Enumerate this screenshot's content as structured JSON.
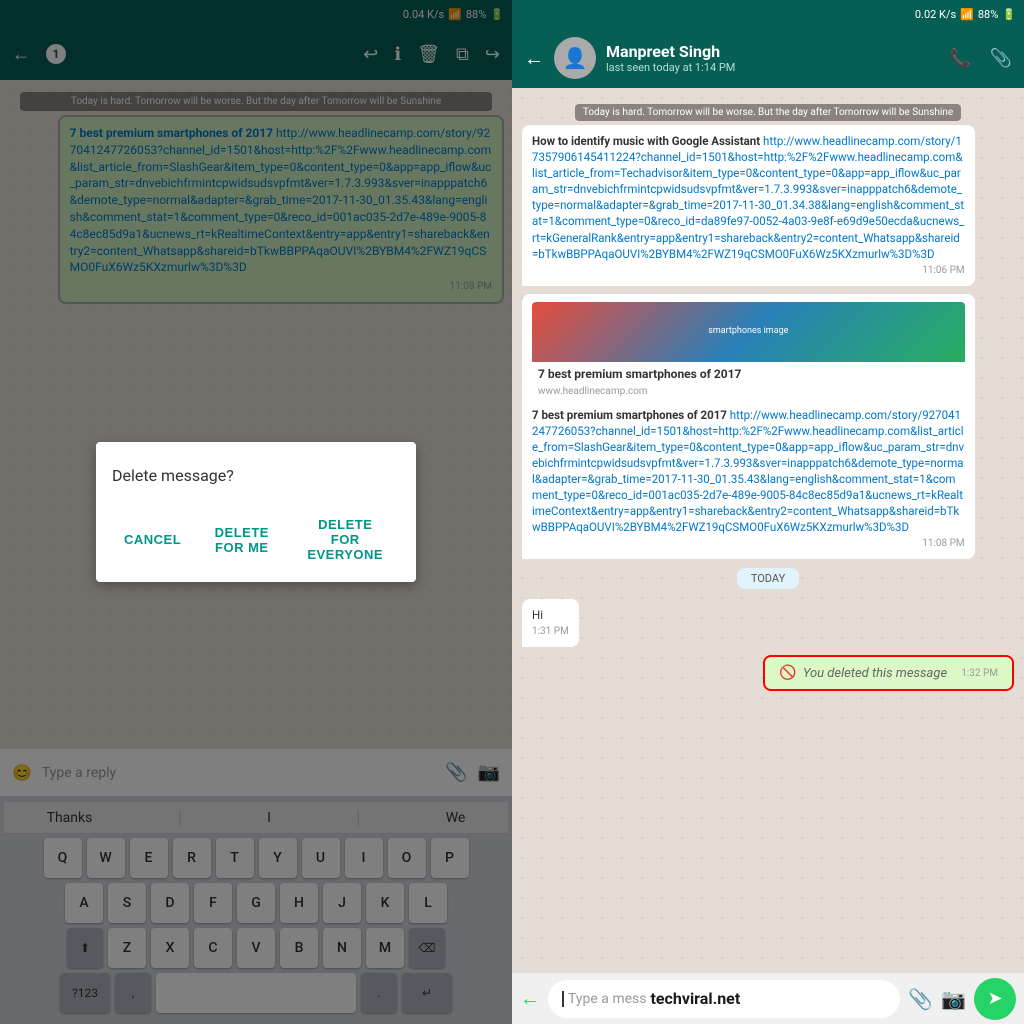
{
  "left": {
    "statusBar": {
      "speed": "0.04 K/s",
      "battery": "88%"
    },
    "toolbar": {
      "badge": "1",
      "backIcon": "←",
      "infoIcon": "ℹ",
      "deleteIcon": "🗑",
      "copyIcon": "⧉",
      "forwardIcon": "↪"
    },
    "chatBanner": "Today is hard. Tomorrow will be worse. But the day after Tomorrow will be Sunshine",
    "messages": [
      {
        "type": "sent",
        "text": "7 best premium smartphones of 2017",
        "link": "http://www.headlinecamp.com/story/927041247726053?channel_id=1501&host=http:%2F%2Fwww.headlinecamp.com&list_article_from=SlashGear&item_type=0&content_type=0&app=app_iflow&uc_param_str=dnvebichfrmintcpwidsudsvpfmt&ver=1.7.3.993&sver=inapppatch6&demote_type=normal&adapter=&grab_time=2017-11-30_01.35.43&lang=english&comment_stat=1&comment_type=0&reco_id=001ac035-2d7e-489e-9005-84c8ec85d9a1&ucnews_rt=kRealtimeContext&entry=app&entry1=shareback&entry2=content_Whatsapp&shareid=bTkwBBPPAqaOUVI%2BYBM4%2FWZ19qCSMO0FuX6Wz5KXzmurlw%3D%3D",
        "time": "11:08 PM"
      }
    ],
    "dialog": {
      "title": "Delete message?",
      "cancel": "CANCEL",
      "deleteForMe": "DELETE FOR ME",
      "deleteForEveryone": "DELETE FOR EVERYONE"
    },
    "replyBar": {
      "placeholder": "Type a reply"
    },
    "keyboard": {
      "suggestions": [
        "Thanks",
        "I",
        "We"
      ],
      "rows": [
        [
          "Q",
          "W",
          "E",
          "R",
          "T",
          "Y",
          "U",
          "I",
          "O",
          "P"
        ],
        [
          "A",
          "S",
          "D",
          "F",
          "G",
          "H",
          "J",
          "K",
          "L"
        ],
        [
          "Z",
          "X",
          "C",
          "V",
          "B",
          "N",
          "M"
        ]
      ]
    }
  },
  "right": {
    "statusBar": {
      "speed": "0.02 K/s",
      "battery": "88%"
    },
    "contact": {
      "name": "Manpreet Singh",
      "status": "last seen today at 1:14 PM",
      "avatarEmoji": "👤"
    },
    "messages": [
      {
        "type": "received",
        "banner": "Today is hard. Tomorrow will be worse. But the day after Tomorrow will be Sunshine",
        "text": "How to identify music with Google Assistant",
        "link": "http://www.headlinecamp.com/story/17357906145411224?channel_id=1501&host=http:%2F%2Fwww.headlinecamp.com&list_article_from=Techadvisor&item_type=0&content_type=0&app=app_iflow&uc_param_str=dnvebichfrmintcpwidsudsvpfmt&ver=1.7.3.993&sver=inapppatch6&demote_type=normal&adapter=&grab_time=2017-11-30_01.34.38&lang=english&comment_stat=1&comment_type=0&reco_id=da89fe97-0052-4a03-9e8f-e69d9e50ecda&ucnews_rt=kGeneralRank&entry=app&entry1=shareback&entry2=content_Whatsapp&shareid=bTkwBBPPAqaOUVI%2BYBM4%2FWZ19qCSMO0FuX6Wz5KXzmurlw%3D%3D",
        "time": "11:06 PM"
      },
      {
        "type": "received",
        "hasCard": true,
        "cardTitle": "7 best premium smartphones of 2017",
        "cardUrl": "www.headlinecamp.com",
        "text": "7 best premium smartphones of 2017",
        "link": "http://www.headlinecamp.com/story/927041247726053?channel_id=1501&host=http:%2F%2Fwww.headlinecamp.com&list_article_from=SlashGear&item_type=0&content_type=0&app=app_iflow&uc_param_str=dnvebichfrmintcpwidsudsvpfmt&ver=1.7.3.993&sver=inapppatch6&demote_type=normal&adapter=&grab_time=2017-11-30_01.35.43&lang=english&comment_stat=1&comment_type=0&reco_id=001ac035-2d7e-489e-9005-84c8ec85d9a1&ucnews_rt=kRealtimeContext&entry=app&entry1=shareback&entry2=content_Whatsapp&shareid=bTkwBBPPAqaOUVI%2BYBM4%2FWZ19qCSMO0FuX6Wz5KXzmurlw%3D%3D",
        "time": "11:08 PM"
      }
    ],
    "todayBadge": "TODAY",
    "recentMessages": [
      {
        "type": "received",
        "text": "Hi",
        "time": "1:31 PM"
      },
      {
        "type": "deleted",
        "text": "You deleted this message",
        "time": "1:32 PM"
      }
    ],
    "inputBar": {
      "placeholder": "Type a mess",
      "watermark": "techviral.net"
    }
  }
}
